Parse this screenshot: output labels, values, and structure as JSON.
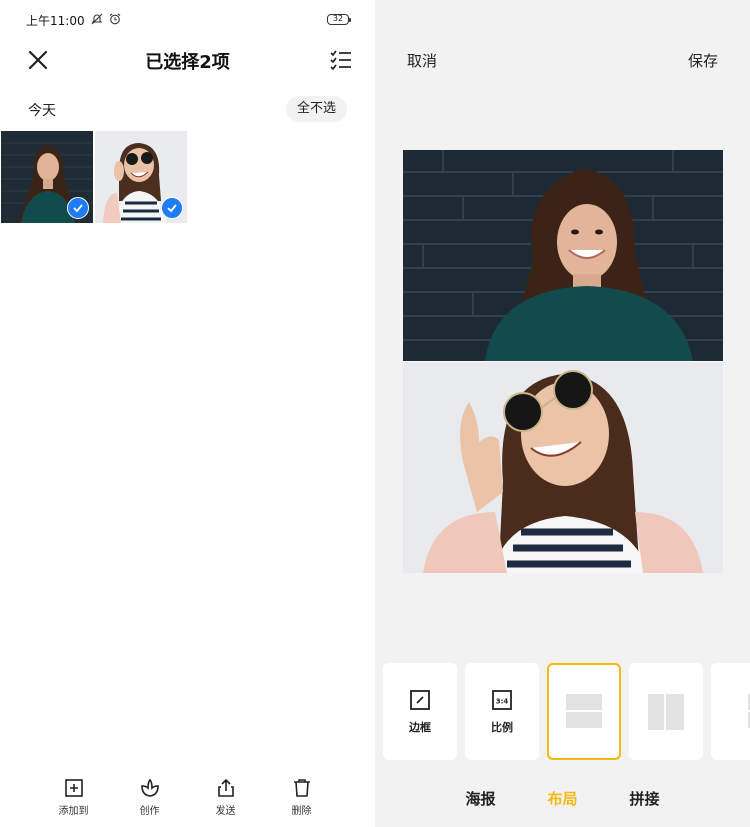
{
  "status_bar": {
    "time": "上午11:00",
    "battery": "32"
  },
  "left": {
    "title": "已选择2项",
    "section_label": "今天",
    "deselect_all": "全不选",
    "actions": [
      {
        "label": "添加到",
        "icon": "add-to-icon"
      },
      {
        "label": "创作",
        "icon": "create-icon"
      },
      {
        "label": "发送",
        "icon": "share-icon"
      },
      {
        "label": "删除",
        "icon": "trash-icon"
      }
    ]
  },
  "right": {
    "cancel": "取消",
    "save": "保存",
    "tools": [
      {
        "label": "边框",
        "icon": "border-icon"
      },
      {
        "label": "比例",
        "icon": "ratio-icon",
        "icon_text": "3:4"
      },
      {
        "label": "",
        "icon": "layout-horizontal-icon",
        "active": true
      },
      {
        "label": "",
        "icon": "layout-vertical-icon"
      }
    ],
    "tabs": [
      {
        "label": "海报"
      },
      {
        "label": "布局",
        "active": true
      },
      {
        "label": "拼接"
      }
    ]
  },
  "colors": {
    "accent": "#f5b914",
    "check_blue": "#1f7cf7",
    "panel_bg": "#f2f2f2"
  }
}
